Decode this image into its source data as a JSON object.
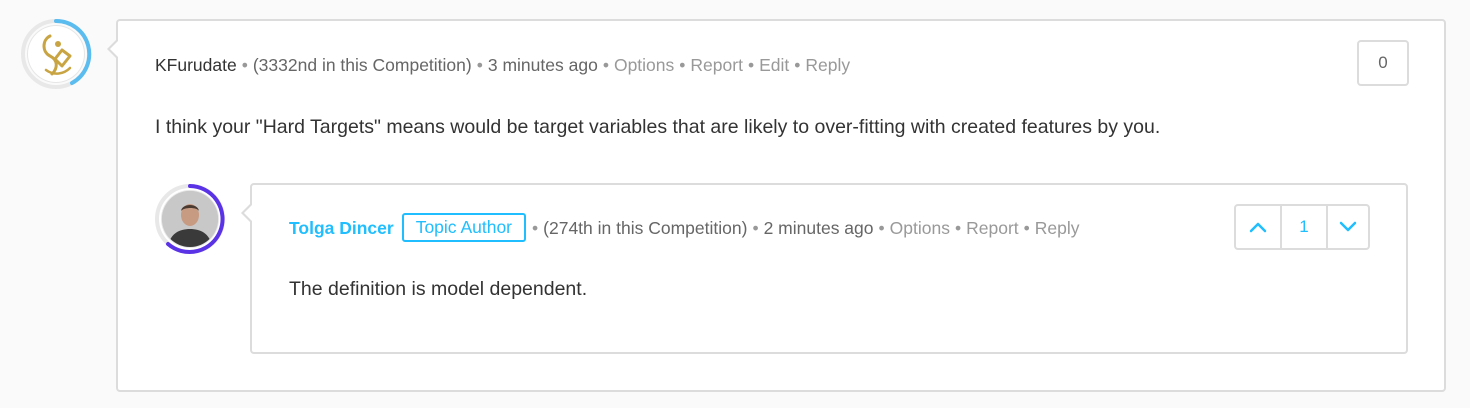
{
  "colors": {
    "accent": "#20beff",
    "ring_blue": "#5bbcf0",
    "ring_purple": "#5b33e6",
    "border": "#dcdcdc",
    "gold": "#c9a442"
  },
  "comment": {
    "author": "KFurudate",
    "rank": "(3332nd in this Competition)",
    "time": "3 minutes ago",
    "actions": [
      "Options",
      "Report",
      "Edit",
      "Reply"
    ],
    "body": "I think your \"Hard Targets\" means would be target variables that are likely to over-fitting with created features by you.",
    "votes": "0",
    "avatar_icon": "gold-emblem-icon"
  },
  "reply": {
    "author": "Tolga Dincer",
    "badge": "Topic Author",
    "rank": "(274th in this Competition)",
    "time": "2 minutes ago",
    "actions": [
      "Options",
      "Report",
      "Reply"
    ],
    "body": "The definition is model dependent.",
    "votes": "1",
    "avatar_icon": "user-photo-icon"
  }
}
